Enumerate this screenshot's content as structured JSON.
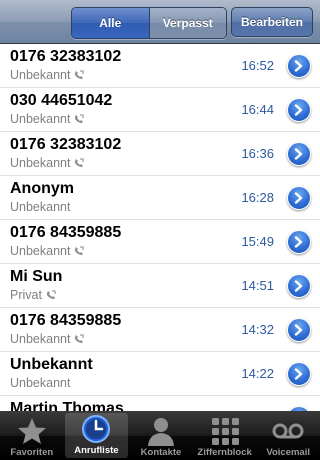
{
  "navbar": {
    "segments": [
      "Alle",
      "Verpasst"
    ],
    "edit_label": "Bearbeiten"
  },
  "calls": [
    {
      "name": "0176 32383102",
      "detail": "Unbekannt",
      "phone_icon": true,
      "time": "16:52"
    },
    {
      "name": "030 44651042",
      "detail": "Unbekannt",
      "phone_icon": true,
      "time": "16:44"
    },
    {
      "name": "0176 32383102",
      "detail": "Unbekannt",
      "phone_icon": true,
      "time": "16:36"
    },
    {
      "name": "Anonym",
      "detail": "Unbekannt",
      "phone_icon": false,
      "time": "16:28"
    },
    {
      "name": "0176 84359885",
      "detail": "Unbekannt",
      "phone_icon": true,
      "time": "15:49"
    },
    {
      "name": "Mi Sun",
      "detail": "Privat",
      "phone_icon": true,
      "time": "14:51"
    },
    {
      "name": "0176 84359885",
      "detail": "Unbekannt",
      "phone_icon": true,
      "time": "14:32"
    },
    {
      "name": "Unbekannt",
      "detail": "Unbekannt",
      "phone_icon": false,
      "time": "14:22"
    },
    {
      "name": "Martin Thomas",
      "detail": "",
      "phone_icon": false,
      "time": ""
    }
  ],
  "tabs": [
    {
      "label": "Favoriten",
      "icon": "star-icon",
      "active": false
    },
    {
      "label": "Anrufliste",
      "icon": "clock-icon",
      "active": true
    },
    {
      "label": "Kontakte",
      "icon": "person-icon",
      "active": false
    },
    {
      "label": "Ziffernblock",
      "icon": "keypad-icon",
      "active": false
    },
    {
      "label": "Voicemail",
      "icon": "voicemail-icon",
      "active": false
    }
  ],
  "colors": {
    "time_text": "#2c5aa0",
    "segment_active": "#3f68b9",
    "disclosure": "#2f6fd6"
  }
}
